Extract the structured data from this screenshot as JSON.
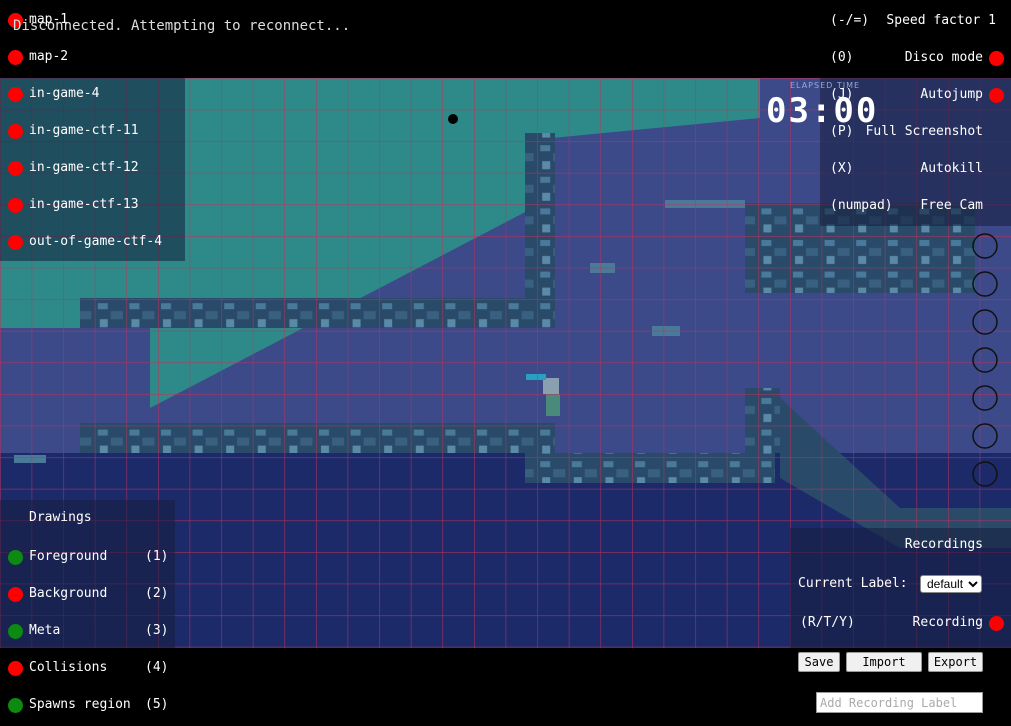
{
  "status": "Disconnected. Attempting to reconnect...",
  "maps": [
    {
      "label": "map-1",
      "active": false
    },
    {
      "label": "map-2",
      "active": false
    },
    {
      "label": "in-game-4",
      "active": false
    },
    {
      "label": "in-game-ctf-11",
      "active": false
    },
    {
      "label": "in-game-ctf-12",
      "active": false
    },
    {
      "label": "in-game-ctf-13",
      "active": false
    },
    {
      "label": "out-of-game-ctf-4",
      "active": false
    }
  ],
  "controls": [
    {
      "key": "(-/=)",
      "label": "Speed factor 1"
    },
    {
      "key": "(0)",
      "label": "Disco mode",
      "enabled": false
    },
    {
      "key": "(J)",
      "label": "Autojump",
      "enabled": false
    },
    {
      "key": "(P)",
      "label": "Full Screenshot"
    },
    {
      "key": "(X)",
      "label": "Autokill"
    },
    {
      "key": "(numpad)",
      "label": "Free Cam"
    }
  ],
  "timer": {
    "label": "ELAPSED TIME",
    "value": "03:00"
  },
  "drawings": {
    "title": "Drawings",
    "layers": [
      {
        "label": "Foreground",
        "key": "(1)",
        "enabled": true
      },
      {
        "label": "Background",
        "key": "(2)",
        "enabled": false
      },
      {
        "label": "Meta",
        "key": "(3)",
        "enabled": true
      },
      {
        "label": "Collisions",
        "key": "(4)",
        "enabled": false
      },
      {
        "label": "Spawns region",
        "key": "(5)",
        "enabled": true
      }
    ]
  },
  "recordings": {
    "title": "Recordings",
    "current_label_text": "Current Label:",
    "selected_label": "default",
    "options": [
      "default"
    ],
    "recording_key": "(R/T/Y)",
    "recording_label": "Recording",
    "recording_active": false,
    "save_label": "Save",
    "import_label": "Import",
    "export_label": "Export",
    "add_placeholder": "Add Recording Label"
  },
  "colors": {
    "off": "#ff0000",
    "on": "#0d8a12",
    "grid_line": "#c0305a",
    "sky": "#3c4a8a",
    "spawn_region": "#2aa088"
  }
}
